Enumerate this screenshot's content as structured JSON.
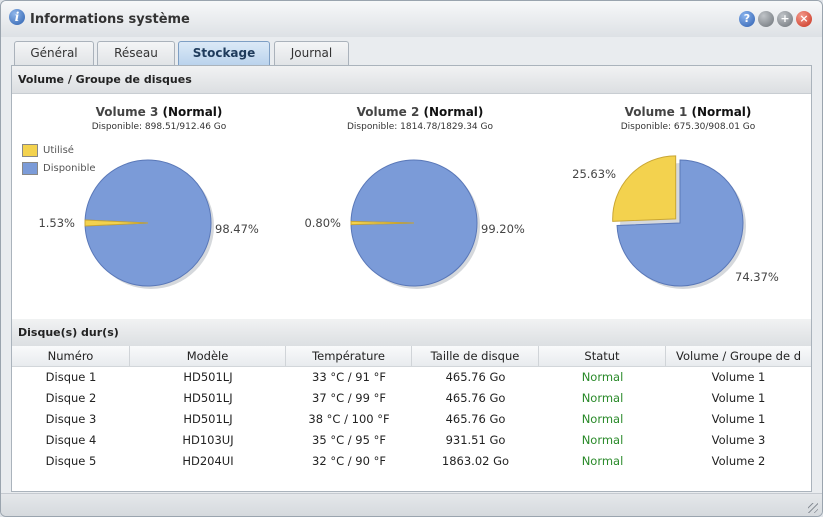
{
  "window": {
    "title": "Informations système",
    "buttons": [
      "?",
      "",
      "+",
      "×"
    ]
  },
  "tabs": [
    {
      "label": "Général",
      "active": false
    },
    {
      "label": "Réseau",
      "active": false
    },
    {
      "label": "Stockage",
      "active": true
    },
    {
      "label": "Journal",
      "active": false
    }
  ],
  "volumes_section": {
    "header": "Volume / Groupe de disques",
    "legend": [
      {
        "label": "Utilisé",
        "color": "#f3d24e"
      },
      {
        "label": "Disponible",
        "color": "#7b9bd8"
      }
    ],
    "volumes": [
      {
        "name": "Volume 3 ",
        "status": "(Normal)",
        "available": "Disponible: 898.51/912.46 Go",
        "used_label": "1.53%",
        "avail_label": "98.47%",
        "used_fraction": 0.0153
      },
      {
        "name": "Volume 2 ",
        "status": "(Normal)",
        "available": "Disponible: 1814.78/1829.34 Go",
        "used_label": "0.80%",
        "avail_label": "99.20%",
        "used_fraction": 0.008
      },
      {
        "name": "Volume 1 ",
        "status": "(Normal)",
        "available": "Disponible: 675.30/908.01 Go",
        "used_label": "25.63%",
        "avail_label": "74.37%",
        "used_fraction": 0.2563
      }
    ]
  },
  "disks_section": {
    "header": "Disque(s) dur(s)",
    "columns": [
      "Numéro",
      "Modèle",
      "Température",
      "Taille de disque",
      "Statut",
      "Volume / Groupe de d"
    ],
    "rows": [
      [
        "Disque 1",
        "HD501LJ",
        "33 °C / 91 °F",
        "465.76 Go",
        "Normal",
        "Volume 1"
      ],
      [
        "Disque 2",
        "HD501LJ",
        "37 °C / 99 °F",
        "465.76 Go",
        "Normal",
        "Volume 1"
      ],
      [
        "Disque 3",
        "HD501LJ",
        "38 °C / 100 °F",
        "465.76 Go",
        "Normal",
        "Volume 1"
      ],
      [
        "Disque 4",
        "HD103UJ",
        "35 °C / 95 °F",
        "931.51 Go",
        "Normal",
        "Volume 3"
      ],
      [
        "Disque 5",
        "HD204UI",
        "32 °C / 90 °F",
        "1863.02 Go",
        "Normal",
        "Volume 2"
      ]
    ]
  },
  "chart_data": {
    "type": "pie",
    "charts": [
      {
        "title": "Volume 3 (Normal)",
        "slices": [
          {
            "label": "Utilisé",
            "value": 1.53
          },
          {
            "label": "Disponible",
            "value": 98.47
          }
        ]
      },
      {
        "title": "Volume 2 (Normal)",
        "slices": [
          {
            "label": "Utilisé",
            "value": 0.8
          },
          {
            "label": "Disponible",
            "value": 99.2
          }
        ]
      },
      {
        "title": "Volume 1 (Normal)",
        "slices": [
          {
            "label": "Utilisé",
            "value": 25.63
          },
          {
            "label": "Disponible",
            "value": 74.37
          }
        ]
      }
    ]
  }
}
